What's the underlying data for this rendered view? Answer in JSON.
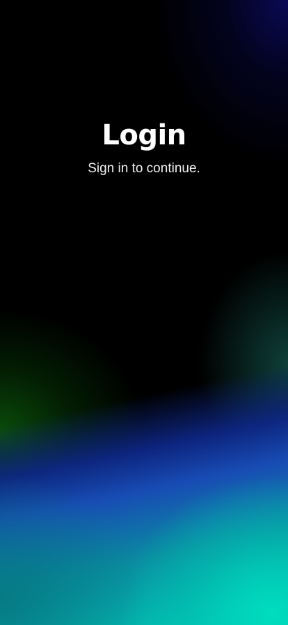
{
  "login": {
    "title": "Login",
    "subtitle": "Sign in to continue."
  },
  "colors": {
    "background": "#000000",
    "navy_glow": "#0a0a5a",
    "green_glow": "#0a500a",
    "blue_band": "#1950be",
    "teal_bottom": "#00c8b4",
    "text": "#ffffff"
  }
}
